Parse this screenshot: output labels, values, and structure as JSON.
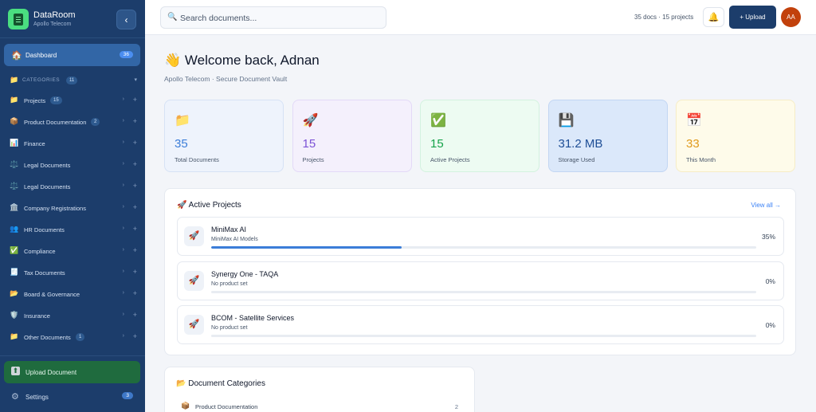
{
  "brand": {
    "name": "DataRoom",
    "subtitle": "Apollo Telecom"
  },
  "sidebar": {
    "dashboard": {
      "label": "Dashboard",
      "count": "36"
    },
    "categories_header": {
      "label": "CATEGORIES",
      "count": "11"
    },
    "categories": [
      {
        "icon": "📁",
        "label": "Projects",
        "count": "15"
      },
      {
        "icon": "📦",
        "label": "Product Documentation",
        "count": "2"
      },
      {
        "icon": "📊",
        "label": "Finance",
        "count": ""
      },
      {
        "icon": "⚖️",
        "label": "Legal Documents",
        "count": ""
      },
      {
        "icon": "⚖️",
        "label": "Legal Documents",
        "count": ""
      },
      {
        "icon": "🏛️",
        "label": "Company Registrations",
        "count": ""
      },
      {
        "icon": "👥",
        "label": "HR Documents",
        "count": ""
      },
      {
        "icon": "✅",
        "label": "Compliance",
        "count": ""
      },
      {
        "icon": "🧾",
        "label": "Tax Documents",
        "count": ""
      },
      {
        "icon": "📂",
        "label": "Board & Governance",
        "count": ""
      },
      {
        "icon": "🛡️",
        "label": "Insurance",
        "count": ""
      },
      {
        "icon": "📁",
        "label": "Other Documents",
        "count": "1"
      }
    ],
    "upload": {
      "label": "Upload Document"
    },
    "settings": {
      "label": "Settings",
      "count": "3"
    }
  },
  "topbar": {
    "search_placeholder": "Search documents...",
    "doc_counts": "35 docs · 15 projects",
    "upload_label": "+ Upload",
    "avatar_initials": "AA"
  },
  "welcome": {
    "title": "👋 Welcome back, Adnan",
    "subtitle": "Apollo Telecom · Secure Document Vault"
  },
  "stats": [
    {
      "icon": "📁",
      "value": "35",
      "label": "Total Documents",
      "bg": "#eef3fc",
      "border": "#d6e2f5",
      "color": "#3b7dd8"
    },
    {
      "icon": "🚀",
      "value": "15",
      "label": "Projects",
      "bg": "#f4f0fc",
      "border": "#e3d9f7",
      "color": "#7c52d6"
    },
    {
      "icon": "✅",
      "value": "15",
      "label": "Active Projects",
      "bg": "#edfbf2",
      "border": "#d3f2df",
      "color": "#16a34a"
    },
    {
      "icon": "💾",
      "value": "31.2 MB",
      "label": "Storage Used",
      "bg": "#dbe8fa",
      "border": "#c2d6f3",
      "color": "#1e4e96"
    },
    {
      "icon": "📅",
      "value": "33",
      "label": "This Month",
      "bg": "#fefbea",
      "border": "#f6edc6",
      "color": "#e09a1a"
    }
  ],
  "active_projects": {
    "title": "🚀 Active Projects",
    "view_all": "View all →",
    "items": [
      {
        "icon": "🚀",
        "name": "MiniMax AI",
        "subtitle": "MiniMax AI Models",
        "progress": 35,
        "pct_label": "35%"
      },
      {
        "icon": "🚀",
        "name": "Synergy One - TAQA",
        "subtitle": "No product set",
        "progress": 0,
        "pct_label": "0%"
      },
      {
        "icon": "🚀",
        "name": "BCOM - Satellite Services",
        "subtitle": "No product set",
        "progress": 0,
        "pct_label": "0%"
      }
    ]
  },
  "doc_categories": {
    "title": "📂 Document Categories",
    "first_row": {
      "icon": "📦",
      "label": "Product Documentation",
      "count": "2"
    }
  }
}
